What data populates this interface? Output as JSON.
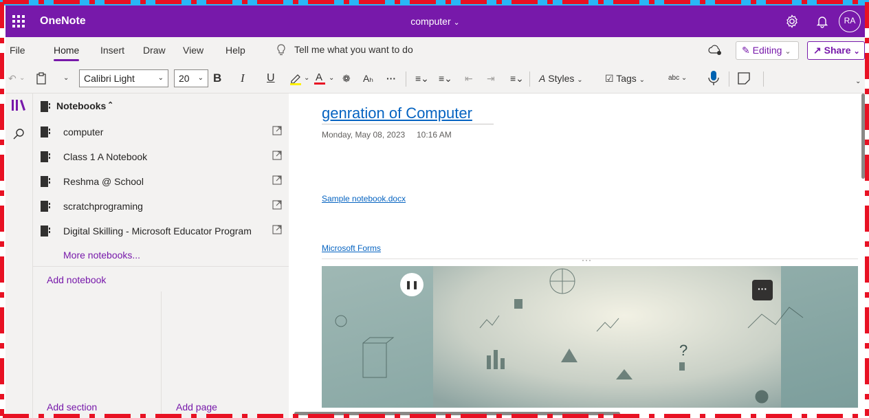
{
  "app": {
    "name": "OneNote",
    "document_title": "computer",
    "avatar_initials": "RA"
  },
  "menubar": {
    "tabs": [
      "File",
      "Home",
      "Insert",
      "Draw",
      "View",
      "Help"
    ],
    "active_tab": "Home",
    "tell_me": "Tell me what you want to do",
    "editing_label": "Editing",
    "share_label": "Share"
  },
  "ribbon": {
    "font_name": "Calibri Light",
    "font_size": "20",
    "bold": "B",
    "italic": "I",
    "underline": "U",
    "more": "···",
    "styles_label": "Styles",
    "tags_label": "Tags",
    "spell_label": "abc"
  },
  "notebooks": {
    "header": "Notebooks",
    "items": [
      {
        "label": "computer"
      },
      {
        "label": "Class 1 A Notebook"
      },
      {
        "label": "Reshma @ School"
      },
      {
        "label": "scratchprograming"
      },
      {
        "label": "Digital Skilling - Microsoft Educator Program"
      }
    ],
    "more_label": "More notebooks...",
    "add_notebook": "Add notebook",
    "add_section": "Add section",
    "add_page": "Add page"
  },
  "page": {
    "title": "genration of Computer",
    "date": "Monday, May 08, 2023",
    "time": "10:16 AM",
    "links": [
      "Sample notebook.docx",
      "Microsoft Forms"
    ],
    "embed_more": "···"
  },
  "colors": {
    "brand": "#7719aa",
    "link": "#0563c1",
    "pane_bg": "#f3f2f1",
    "frame": "#e81123"
  }
}
